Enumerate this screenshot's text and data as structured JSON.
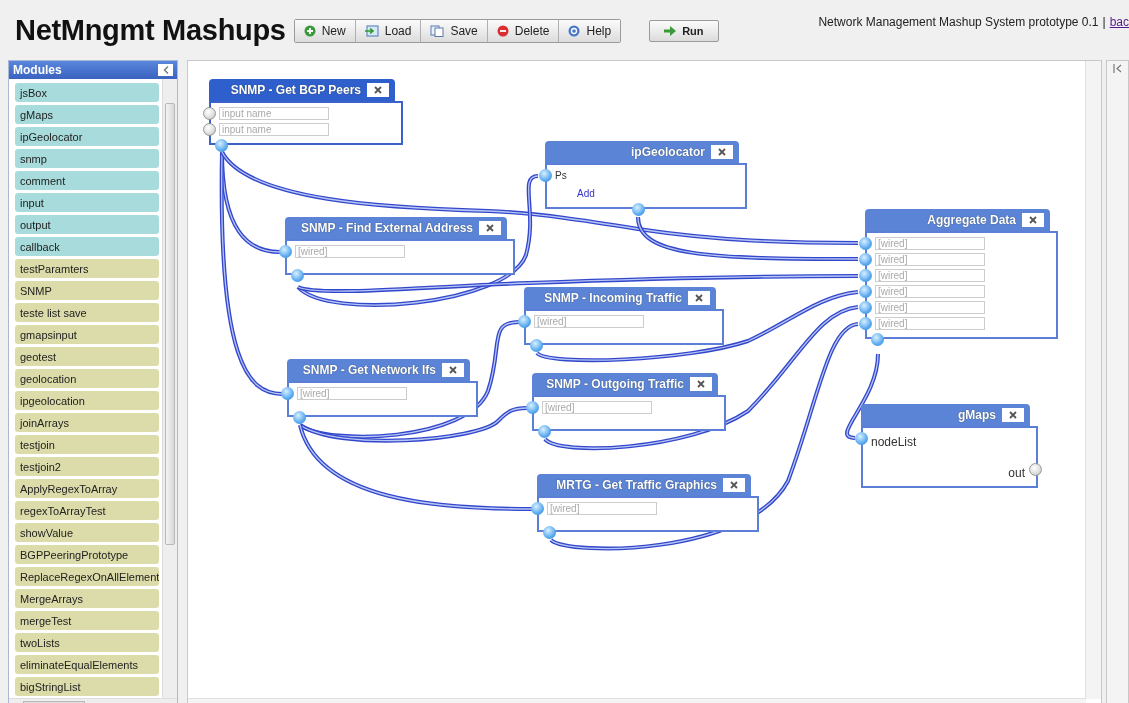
{
  "header": {
    "title": "NetMngmt Mashups",
    "toolbar": [
      {
        "label": "New",
        "kind": "new"
      },
      {
        "label": "Load",
        "kind": "load"
      },
      {
        "label": "Save",
        "kind": "save"
      },
      {
        "label": "Delete",
        "kind": "delete"
      },
      {
        "label": "Help",
        "kind": "help"
      }
    ],
    "run_button": "Run",
    "info": "Network Management Mashup System prototype 0.1",
    "info_separator": "|",
    "info_link": "bac"
  },
  "sidebar": {
    "title": "Modules",
    "items": [
      {
        "label": "jsBox",
        "kind": "builtin"
      },
      {
        "label": "gMaps",
        "kind": "builtin"
      },
      {
        "label": "ipGeolocator",
        "kind": "builtin"
      },
      {
        "label": "snmp",
        "kind": "builtin"
      },
      {
        "label": "comment",
        "kind": "builtin"
      },
      {
        "label": "input",
        "kind": "builtin"
      },
      {
        "label": "output",
        "kind": "builtin"
      },
      {
        "label": "callback",
        "kind": "builtin"
      },
      {
        "label": "testParamters",
        "kind": "user"
      },
      {
        "label": "SNMP",
        "kind": "user"
      },
      {
        "label": "teste list save",
        "kind": "user"
      },
      {
        "label": "gmapsinput",
        "kind": "user"
      },
      {
        "label": "geotest",
        "kind": "user"
      },
      {
        "label": "geolocation",
        "kind": "user"
      },
      {
        "label": "ipgeolocation",
        "kind": "user"
      },
      {
        "label": "joinArrays",
        "kind": "user"
      },
      {
        "label": "testjoin",
        "kind": "user"
      },
      {
        "label": "testjoin2",
        "kind": "user"
      },
      {
        "label": "ApplyRegexToArray",
        "kind": "user"
      },
      {
        "label": "regexToArrayTest",
        "kind": "user"
      },
      {
        "label": "showValue",
        "kind": "user"
      },
      {
        "label": "BGPPeeringPrototype",
        "kind": "user"
      },
      {
        "label": "ReplaceRegexOnAllElement",
        "kind": "user"
      },
      {
        "label": "MergeArrays",
        "kind": "user"
      },
      {
        "label": "mergeTest",
        "kind": "user"
      },
      {
        "label": "twoLists",
        "kind": "user"
      },
      {
        "label": "eliminateEqualElements",
        "kind": "user"
      },
      {
        "label": "bigStringList",
        "kind": "user"
      }
    ]
  },
  "canvas": {
    "modules": [
      {
        "title": "SNMP - Get BGP Peers",
        "selected": true,
        "inputs": [
          {
            "kind": "field",
            "placeholder": "input name",
            "wired": false
          },
          {
            "kind": "field",
            "placeholder": "input name",
            "wired": false
          }
        ],
        "output": {
          "wired": true
        }
      },
      {
        "title": "SNMP - Find External Address",
        "selected": false,
        "inputs": [
          {
            "kind": "field",
            "value": "[wired]",
            "wired": true
          }
        ],
        "output": {
          "wired": true
        }
      },
      {
        "title": "SNMP - Get Network Ifs",
        "selected": false,
        "inputs": [
          {
            "kind": "field",
            "value": "[wired]",
            "wired": true
          }
        ],
        "output": {
          "wired": true
        }
      },
      {
        "title": "ipGeolocator",
        "selected": false,
        "inputs": [
          {
            "kind": "label",
            "text": "Ps",
            "wired": true
          }
        ],
        "link": "Add",
        "output": {
          "wired": true
        }
      },
      {
        "title": "SNMP - Incoming Traffic",
        "selected": false,
        "inputs": [
          {
            "kind": "field",
            "value": "[wired]",
            "wired": true
          }
        ],
        "output": {
          "wired": true
        }
      },
      {
        "title": "SNMP - Outgoing Traffic",
        "selected": false,
        "inputs": [
          {
            "kind": "field",
            "value": "[wired]",
            "wired": true
          }
        ],
        "output": {
          "wired": true
        }
      },
      {
        "title": "MRTG - Get Traffic Graphics",
        "selected": false,
        "inputs": [
          {
            "kind": "field",
            "value": "[wired]",
            "wired": true
          }
        ],
        "output": {
          "wired": true
        }
      },
      {
        "title": "Aggregate Data",
        "selected": false,
        "inputs": [
          {
            "kind": "field",
            "value": "[wired]",
            "wired": true
          },
          {
            "kind": "field",
            "value": "[wired]",
            "wired": true
          },
          {
            "kind": "field",
            "value": "[wired]",
            "wired": true
          },
          {
            "kind": "field",
            "value": "[wired]",
            "wired": true
          },
          {
            "kind": "field",
            "value": "[wired]",
            "wired": true
          },
          {
            "kind": "field",
            "value": "[wired]",
            "wired": true
          }
        ],
        "output": {
          "wired": true
        }
      },
      {
        "title": "gMaps",
        "selected": false,
        "inputs": [
          {
            "kind": "label",
            "text": "nodeList",
            "wired": true
          }
        ],
        "output": {
          "label": "out",
          "wired": false
        }
      }
    ]
  }
}
